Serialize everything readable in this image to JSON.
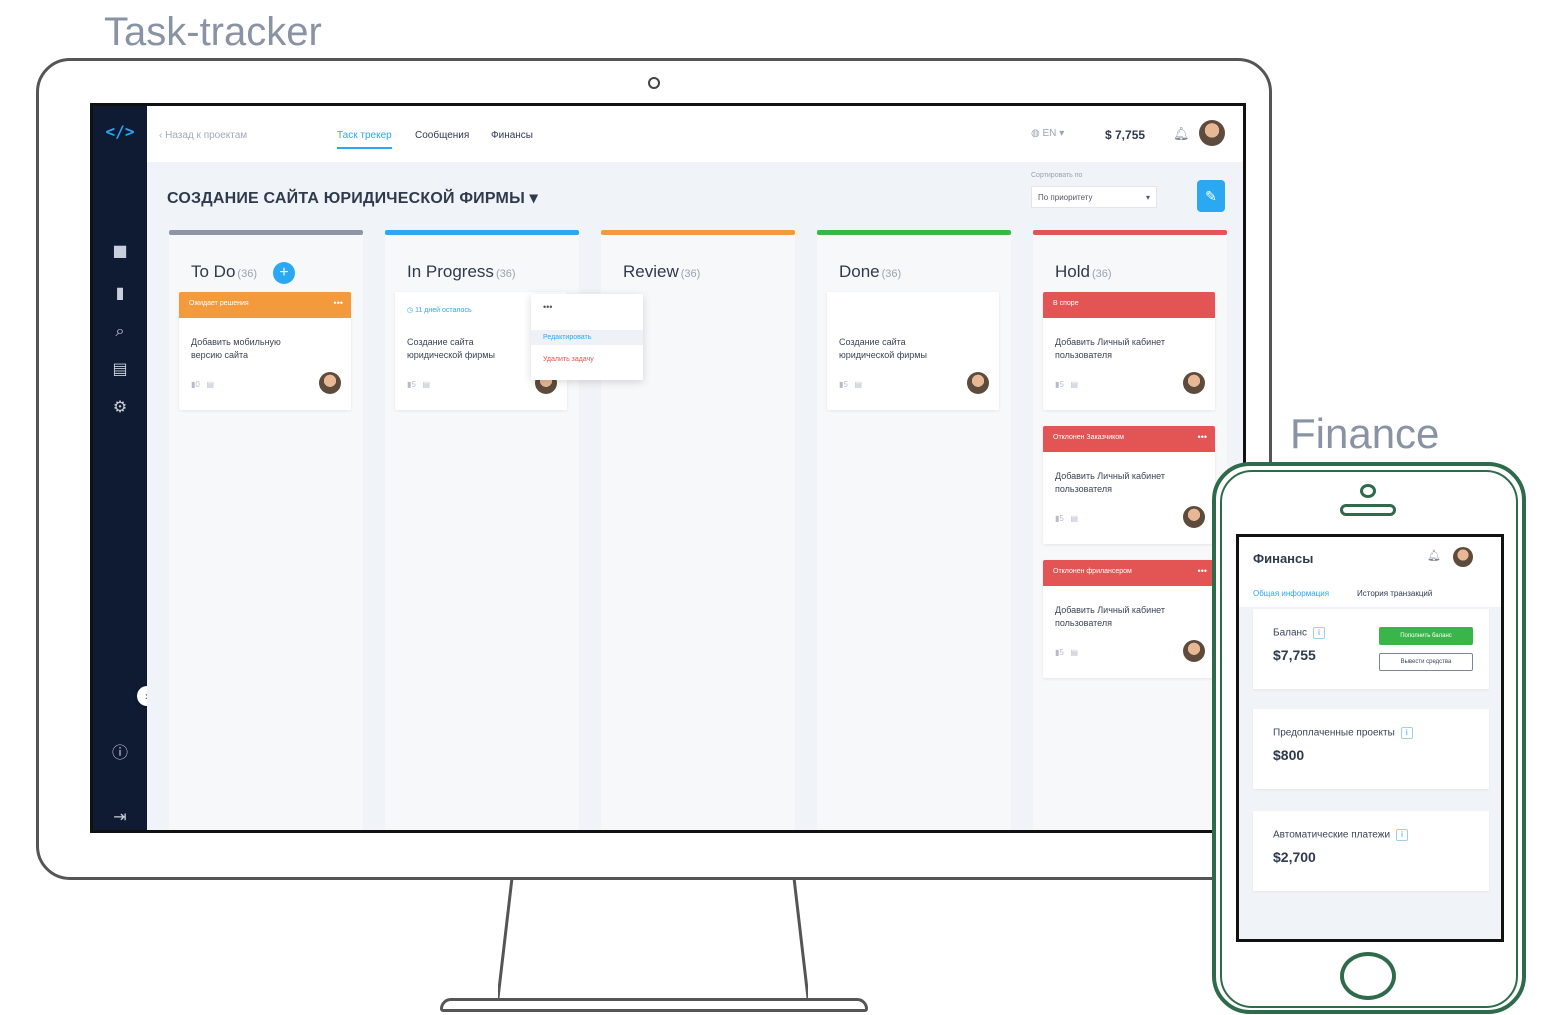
{
  "captions": {
    "task_tracker": "Task-tracker",
    "finance": "Finance"
  },
  "topbar": {
    "back_label": "Назад к проектам",
    "tabs": [
      {
        "label": "Таск трекер",
        "active": true
      },
      {
        "label": "Сообщения",
        "active": false
      },
      {
        "label": "Финансы",
        "active": false
      }
    ],
    "language": "EN",
    "balance": "$ 7,755"
  },
  "project": {
    "title": "СОЗДАНИЕ САЙТА ЮРИДИЧЕСКОЙ ФИРМЫ ▾",
    "sort_label": "Сортировать по",
    "sort_value": "По приоритету"
  },
  "columns": [
    {
      "title": "To Do",
      "count": "(36)",
      "color": "#8e96a6"
    },
    {
      "title": "In Progress",
      "count": "(36)",
      "color": "#2aa8f2"
    },
    {
      "title": "Review",
      "count": "(36)",
      "color": "#f39a3d"
    },
    {
      "title": "Done",
      "count": "(36)",
      "color": "#3ab54a"
    },
    {
      "title": "Hold",
      "count": "(36)",
      "color": "#e35454"
    }
  ],
  "cards": {
    "todo1": {
      "head": "Ожидает решения",
      "text": "Добавить мобильную версию сайта",
      "meta": "0",
      "head_color": "#f39a3d"
    },
    "progress1": {
      "deadline": "11 дней осталось",
      "text": "Создание сайта юридической фирмы",
      "meta": "5"
    },
    "done1": {
      "text": "Создание сайта юридической фирмы",
      "meta": "5"
    },
    "hold1": {
      "head": "В споре",
      "text": "Добавить Личный кабинет пользователя",
      "meta": "5",
      "head_color": "#e35454"
    },
    "hold2": {
      "head": "Отклонен Заказчиком",
      "text": "Добавить Личный кабинет пользователя",
      "meta": "5",
      "head_color": "#e35454"
    },
    "hold3": {
      "head": "Отклонен фрилансером",
      "text": "Добавить Личный кабинет пользователя",
      "meta": "5",
      "head_color": "#e35454"
    }
  },
  "dropdown": {
    "dots": "•••",
    "edit": "Редактировать",
    "delete": "Удалить задачу"
  },
  "phone": {
    "title": "Финансы",
    "tabs": [
      {
        "label": "Общая информация",
        "active": true
      },
      {
        "label": "История транзакций",
        "active": false
      }
    ],
    "balance_label": "Баланс",
    "balance_value": "$7,755",
    "topup_button": "Пополнить баланс",
    "withdraw_button": "Вывести средства",
    "prepaid_label": "Предоплаченные проекты",
    "prepaid_value": "$800",
    "auto_label": "Автоматические платежи",
    "auto_value": "$2,700"
  },
  "icons": [
    "logo-icon",
    "folder-icon",
    "chart-icon",
    "search-icon",
    "chat-icon",
    "gear-icon",
    "info-icon",
    "logout-icon",
    "bell-icon",
    "globe-icon",
    "edit-icon",
    "comment-icon",
    "attachment-icon"
  ]
}
